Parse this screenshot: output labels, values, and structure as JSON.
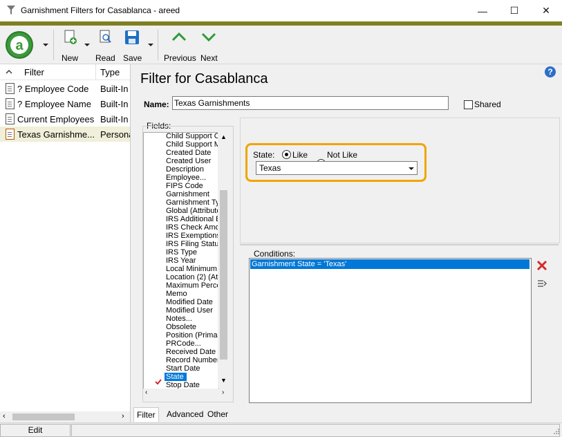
{
  "window": {
    "title": "Garnishment Filters for Casablanca - areed",
    "min": "—",
    "max": "☐",
    "close": "✕"
  },
  "toolbar": {
    "new_label": "New",
    "read_label": "Read",
    "save_label": "Save",
    "previous_label": "Previous",
    "next_label": "Next"
  },
  "filters_list": {
    "col_filter": "Filter",
    "col_type": "Type",
    "rows": [
      {
        "name": "? Employee Code",
        "type": "Built-In"
      },
      {
        "name": "? Employee Name",
        "type": "Built-In"
      },
      {
        "name": "Current Employees",
        "type": "Built-In"
      },
      {
        "name": "Texas Garnishme...",
        "type": "Personal"
      }
    ]
  },
  "main": {
    "heading": "Filter for Casablanca",
    "name_label": "Name:",
    "name_value": "Texas Garnishments",
    "shared_label": "Shared",
    "fields_label": "Fields:",
    "fields": [
      "Child Support C",
      "Child Support M",
      "Created Date",
      "Created User",
      "Description",
      "Employee...",
      "FIPS Code",
      "Garnishment",
      "Garnishment Ty",
      "Global (Attribute",
      "IRS Additional E",
      "IRS Check Amou",
      "IRS Exemptions",
      "IRS Filing Status",
      "IRS Type",
      "IRS Year",
      "Local Minimum W",
      "Location (2) (At",
      "Maximum Perce",
      "Memo",
      "Modified Date",
      "Modified User",
      "Notes...",
      "Obsolete",
      "Position (Primar",
      "PRCode...",
      "Received Date",
      "Record Number",
      "Start Date",
      "State",
      "Stop Date"
    ],
    "state_label": "State:",
    "like_label": "Like",
    "not_like_label": "Not Like",
    "state_value": "Texas",
    "conditions_label": "Conditions:",
    "condition": "Garnishment State = 'Texas'",
    "tabs": [
      "Filter",
      "Advanced",
      "Other"
    ]
  },
  "status": {
    "edit_label": "Edit"
  },
  "colors": {
    "accent": "#7f7f23",
    "selection": "#0078d7",
    "highlight": "#f0a500",
    "logo": "#3a9a3a"
  }
}
